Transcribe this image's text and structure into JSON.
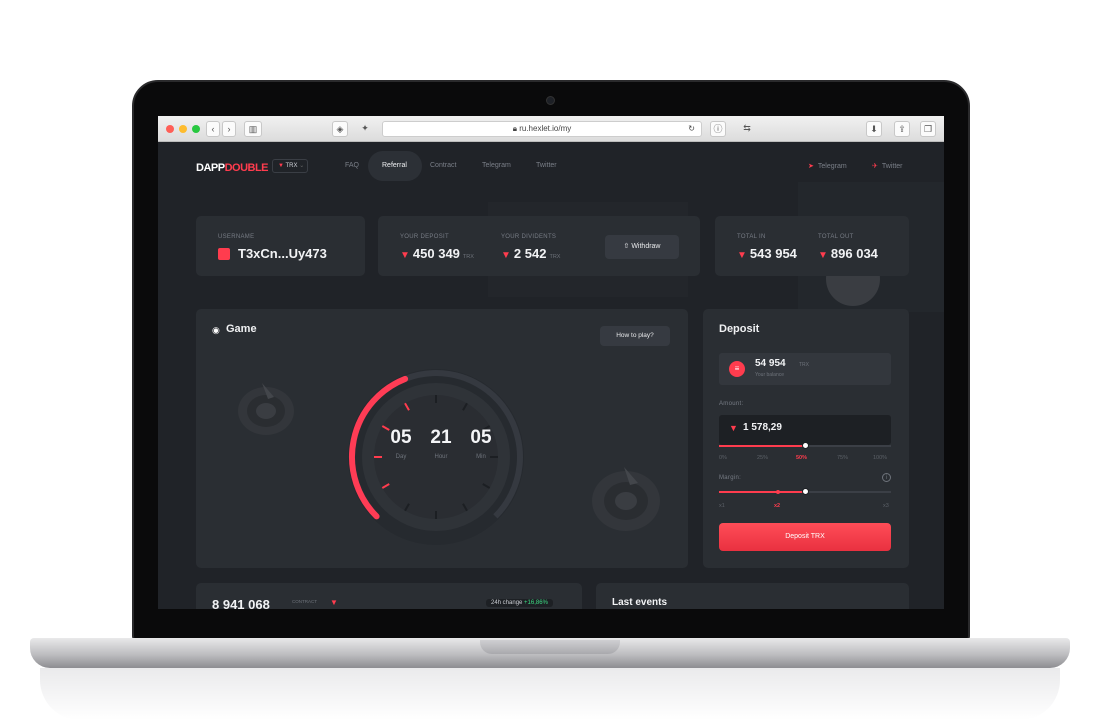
{
  "browser": {
    "url": "ru.hexlet.io/my",
    "traffic_colors": [
      "#ff5f57",
      "#febc2e",
      "#28c840"
    ]
  },
  "header": {
    "logo_a": "DAPP",
    "logo_b": "DOUBLE",
    "currency": "TRX",
    "nav": [
      "FAQ",
      "Referral",
      "Contract",
      "Telegram",
      "Twitter"
    ],
    "active_nav": "Referral",
    "social": [
      "Telegram",
      "Twitter"
    ]
  },
  "user": {
    "label": "USERNAME",
    "value": "T3xCn...Uy473"
  },
  "deposit_stats": {
    "deposit_label": "YOUR DEPOSIT",
    "deposit_value": "450 349",
    "dividends_label": "YOUR DIVIDENTS",
    "dividends_value": "2 542",
    "unit": "TRX",
    "withdraw_label": "Withdraw"
  },
  "totals": {
    "in_label": "TOTAL IN",
    "in_value": "543 954",
    "out_label": "TOTAL OUT",
    "out_value": "896 034"
  },
  "game": {
    "title": "Game",
    "how_to_play": "How to play?",
    "timer": {
      "day": "05",
      "hour": "21",
      "min": "05",
      "day_label": "Day",
      "hour_label": "Hour",
      "min_label": "Min"
    },
    "progress": 0.42
  },
  "deposit": {
    "title": "Deposit",
    "balance_value": "54 954",
    "balance_unit": "TRX",
    "balance_label": "Your balance",
    "amount_label": "Amount:",
    "amount_value": "1 578,29",
    "amount_fraction": 0.5,
    "percentages": [
      "0%",
      "25%",
      "50%",
      "75%",
      "100%"
    ],
    "active_percentage": "50%",
    "margin_label": "Margin:",
    "margin_fraction": 0.5,
    "margin_options": [
      "x1",
      "x2",
      "x3"
    ],
    "active_margin": "x2",
    "button_label": "Deposit TRX"
  },
  "bottom": {
    "contract_value": "8 941 068",
    "contract_label": "CONTRACT",
    "change_label": "24h change",
    "change_value": "+16,86%",
    "last_events_title": "Last events"
  },
  "colors": {
    "accent": "#ff3c4e",
    "positive": "#3ddc84"
  }
}
